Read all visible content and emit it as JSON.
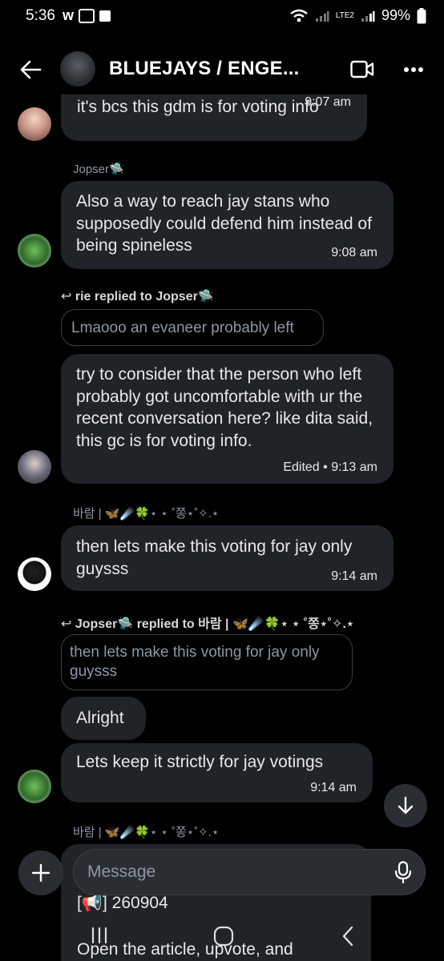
{
  "status": {
    "time": "5:36",
    "battery": "99%",
    "network": "LTE2"
  },
  "header": {
    "title": "BLUEJAYS / ENGE..."
  },
  "messages": {
    "m1": {
      "text": "it's bcs this gdm is for voting info",
      "time": "9:07 am"
    },
    "m2": {
      "sender": "Jopser🛸",
      "text": "Also a way to reach jay stans who supposedly could defend him instead of being spineless",
      "time": "9:08 am"
    },
    "m3": {
      "reply_label": "rie replied to Jopser🛸",
      "quote": "Lmaooo an evaneer probably left",
      "text": "try to consider that the person who left probably got uncomfortable with ur the recent conversation here? like dita said, this gc is for voting info.",
      "time": "Edited • 9:13 am"
    },
    "m4": {
      "sender": "바람 | 🦋☄️🍀⋆ ⋆ ˚쫑⋆˚✧.⋆",
      "text": "then lets make this voting for jay only guysss",
      "time": "9:14 am"
    },
    "m5": {
      "reply_label": "Jopser🛸 replied to 바람 | 🦋☄️🍀⋆ ⋆ ˚쫑⋆˚✧.⋆",
      "quote": "then lets make this voting for jay only guysss",
      "text": "Alright"
    },
    "m6": {
      "text": "Lets keep it strictly for jay votings",
      "time": "9:14 am"
    },
    "m7": {
      "sender": "바람 | 🦋☄️🍀⋆ ⋆ ˚쫑⋆˚✧.⋆",
      "line1": "[📢] 260904",
      "line2": "Open the article, upvote, and"
    }
  },
  "composer": {
    "placeholder": "Message"
  },
  "colors": {
    "bubble": "#202327",
    "background": "#000000",
    "muted": "#8b98a5"
  }
}
